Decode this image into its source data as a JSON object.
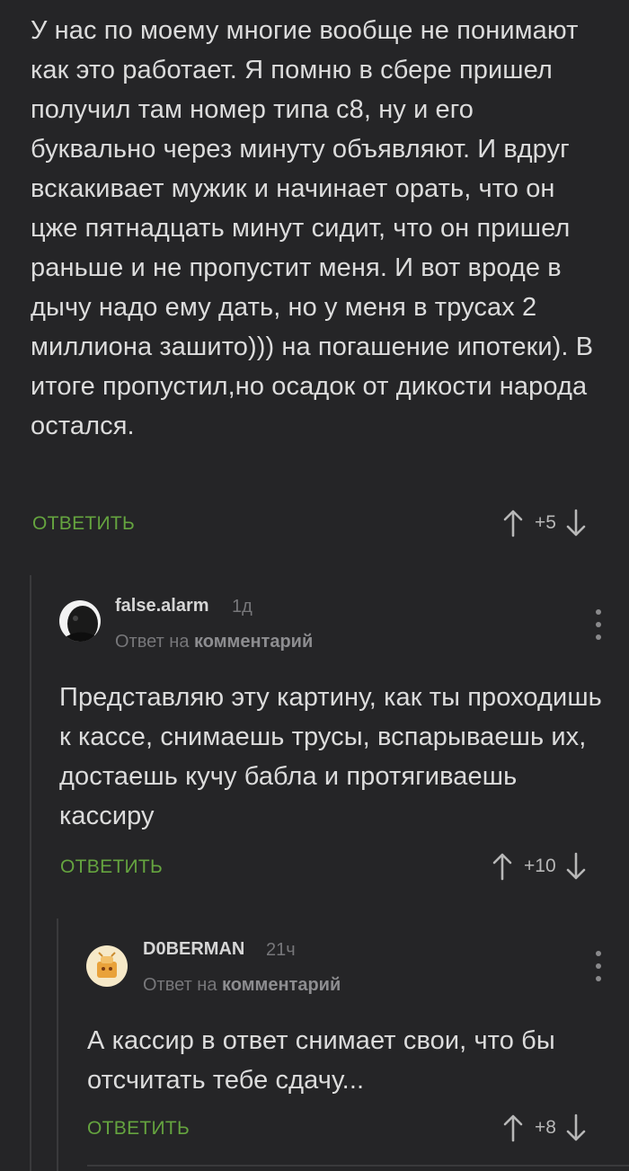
{
  "comments": [
    {
      "text": "У нас по моему многие вообще не понимают как это работает. Я помню в сбере пришел получил там номер типа с8, ну и его буквально через минуту объявляют. И вдруг вскакивает мужик и начинает орать, что он цже пятнадцать минут сидит, что он пришел раньше и не пропустит меня. И вот вроде в дычу надо ему дать, но у меня в трусах 2 миллиона зашито))) на погашение ипотеки). В итоге пропустил,но осадок от дикости народа остался.",
      "reply_label": "ОТВЕТИТЬ",
      "score": "+5"
    },
    {
      "author": "false.alarm",
      "time": "1д",
      "reply_prefix": "Ответ на",
      "reply_link": "комментарий",
      "text": "Представляю эту картину, как ты проходишь к кассе, снимаешь трусы, вспарываешь их, достаешь кучу бабла и протягиваешь кассиру",
      "reply_label": "ОТВЕТИТЬ",
      "score": "+10"
    },
    {
      "author": "D0BERMAN",
      "time": "21ч",
      "reply_prefix": "Ответ на",
      "reply_link": "комментарий",
      "text": "А кассир в ответ снимает свои, что бы отсчитать тебе сдачу...",
      "reply_label": "ОТВЕТИТЬ",
      "score": "+8"
    }
  ],
  "icons": {
    "upvote": "arrow-up-icon",
    "downvote": "arrow-down-icon",
    "menu": "more-vertical-icon"
  },
  "colors": {
    "background": "#252527",
    "reply_button": "#65a43f",
    "text": "#dcdcdc",
    "meta": "#77777a"
  }
}
